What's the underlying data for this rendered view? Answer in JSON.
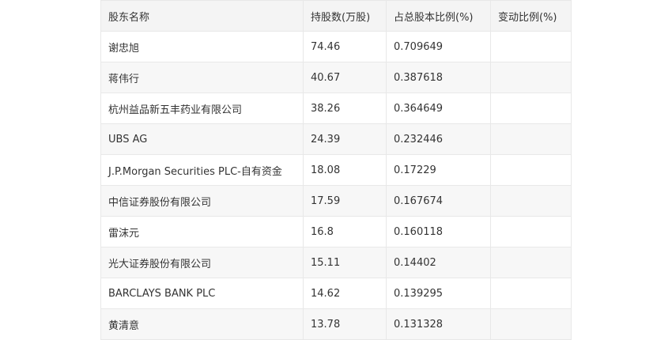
{
  "table": {
    "headers": [
      "股东名称",
      "持股数(万股)",
      "占总股本比例(%)",
      "变动比例(%)"
    ],
    "rows": [
      {
        "name": "谢忠旭",
        "shares": "74.46",
        "ratio": "0.709649",
        "change": ""
      },
      {
        "name": "蒋伟行",
        "shares": "40.67",
        "ratio": "0.387618",
        "change": ""
      },
      {
        "name": "杭州益品新五丰药业有限公司",
        "shares": "38.26",
        "ratio": "0.364649",
        "change": ""
      },
      {
        "name": "UBS AG",
        "shares": "24.39",
        "ratio": "0.232446",
        "change": ""
      },
      {
        "name": "J.P.Morgan Securities PLC-自有资金",
        "shares": "18.08",
        "ratio": "0.17229",
        "change": ""
      },
      {
        "name": "中信证券股份有限公司",
        "shares": "17.59",
        "ratio": "0.167674",
        "change": ""
      },
      {
        "name": "雷沫元",
        "shares": "16.8",
        "ratio": "0.160118",
        "change": ""
      },
      {
        "name": "光大证券股份有限公司",
        "shares": "15.11",
        "ratio": "0.14402",
        "change": ""
      },
      {
        "name": "BARCLAYS BANK PLC",
        "shares": "14.62",
        "ratio": "0.139295",
        "change": ""
      },
      {
        "name": "黄清意",
        "shares": "13.78",
        "ratio": "0.131328",
        "change": ""
      }
    ]
  }
}
